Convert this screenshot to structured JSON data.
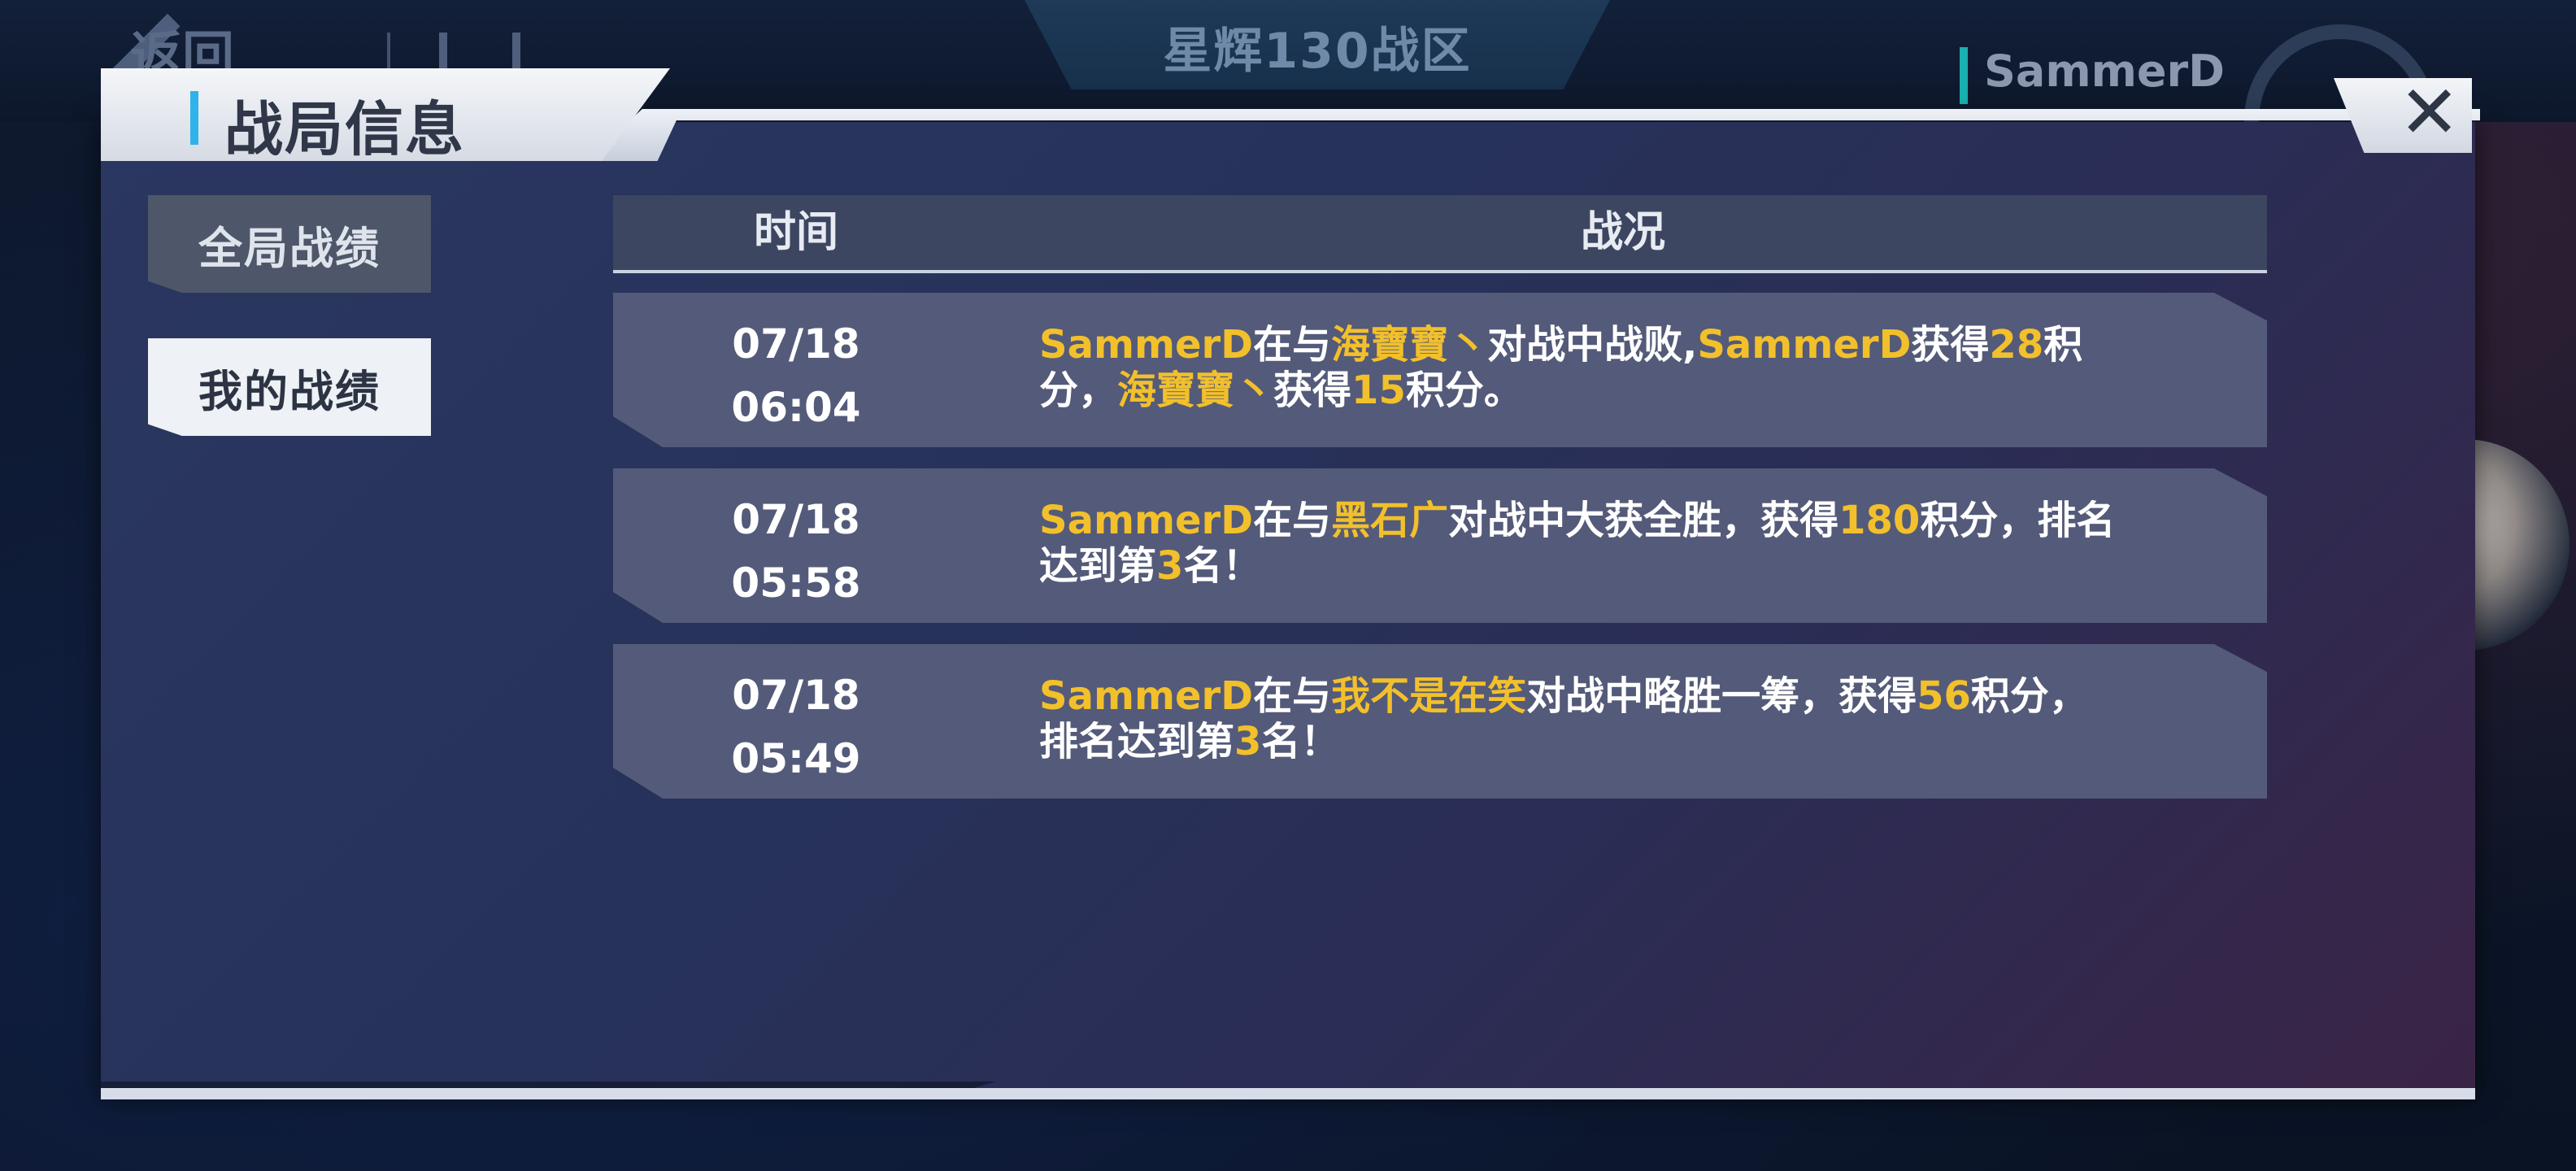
{
  "background": {
    "back_label": "返回",
    "server_banner": "星辉130战区",
    "username": "SammerD"
  },
  "dialog": {
    "title": "战局信息",
    "close_label": "✕"
  },
  "sidebar": {
    "global_record_label": "全局战绩",
    "my_record_label": "我的战绩"
  },
  "table": {
    "headers": {
      "time": "时间",
      "status": "战况"
    },
    "rows": [
      {
        "date": "07/18",
        "time": "06:04",
        "segments": [
          {
            "t": "SammerD",
            "hl": true
          },
          {
            "t": "在与",
            "hl": false
          },
          {
            "t": "海寶寶丶",
            "hl": true
          },
          {
            "t": "对战中战败,",
            "hl": false
          },
          {
            "t": "SammerD",
            "hl": true
          },
          {
            "t": "获得",
            "hl": false
          },
          {
            "t": "28",
            "hl": true
          },
          {
            "t": "积分，",
            "hl": false
          },
          {
            "t": "海寶寶丶",
            "hl": true
          },
          {
            "t": "获得",
            "hl": false
          },
          {
            "t": "15",
            "hl": true
          },
          {
            "t": "积分。",
            "hl": false
          }
        ]
      },
      {
        "date": "07/18",
        "time": "05:58",
        "segments": [
          {
            "t": "SammerD",
            "hl": true
          },
          {
            "t": "在与",
            "hl": false
          },
          {
            "t": "黑石广",
            "hl": true
          },
          {
            "t": "对战中大获全胜，获得",
            "hl": false
          },
          {
            "t": "180",
            "hl": true
          },
          {
            "t": "积分，排名达到第",
            "hl": false
          },
          {
            "t": "3",
            "hl": true
          },
          {
            "t": "名！",
            "hl": false
          }
        ]
      },
      {
        "date": "07/18",
        "time": "05:49",
        "segments": [
          {
            "t": "SammerD",
            "hl": true
          },
          {
            "t": "在与",
            "hl": false
          },
          {
            "t": "我不是在笑",
            "hl": true
          },
          {
            "t": "对战中略胜一筹，获得",
            "hl": false
          },
          {
            "t": "56",
            "hl": true
          },
          {
            "t": "积分，排名达到第",
            "hl": false
          },
          {
            "t": "3",
            "hl": true
          },
          {
            "t": "名！",
            "hl": false
          }
        ]
      }
    ]
  },
  "colors": {
    "highlight": "#f2c02b",
    "accent": "#2fb3e8"
  }
}
